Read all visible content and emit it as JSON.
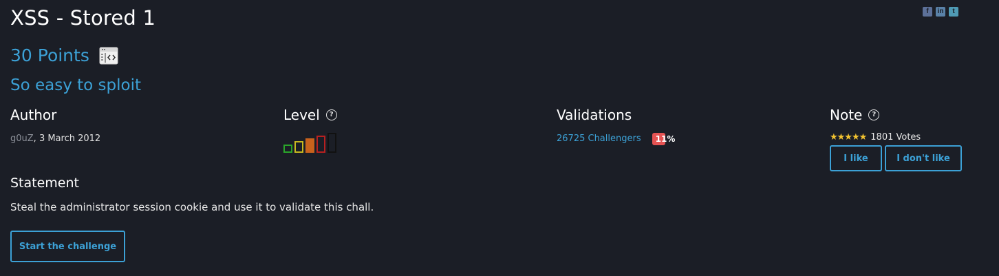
{
  "challenge": {
    "title": "XSS - Stored 1",
    "points": "30 Points",
    "category_icon": "web-client-icon",
    "subtitle": "So easy to sploit"
  },
  "social": {
    "icons": [
      "facebook-icon",
      "linkedin-icon",
      "twitter-icon"
    ]
  },
  "author": {
    "heading": "Author",
    "name": "g0uZ",
    "separator": ",",
    "date": "3 March 2012"
  },
  "level": {
    "heading": "Level",
    "bars": [
      {
        "color": "#2aa52a",
        "filled": false
      },
      {
        "color": "#c8b820",
        "filled": false
      },
      {
        "color": "#c8621c",
        "filled": true
      },
      {
        "color": "#b82020",
        "filled": false
      },
      {
        "color": "#111111",
        "filled": false
      }
    ],
    "active_level": 3
  },
  "validations": {
    "heading": "Validations",
    "challengers": "26725 Challengers",
    "percent_bubble": "11",
    "percent_suffix": "%",
    "bubble_color": "#e55353"
  },
  "note": {
    "heading": "Note",
    "stars": "★★★★★",
    "votes": "1801 Votes",
    "like_label": "I like",
    "dislike_label": "I don't like"
  },
  "statement": {
    "heading": "Statement",
    "text": "Steal the administrator session cookie and use it to validate this chall."
  },
  "actions": {
    "start_label": "Start the challenge"
  },
  "colors": {
    "background": "#1b1e26",
    "accent": "#3ca1d6",
    "text": "#e6e6e6"
  }
}
